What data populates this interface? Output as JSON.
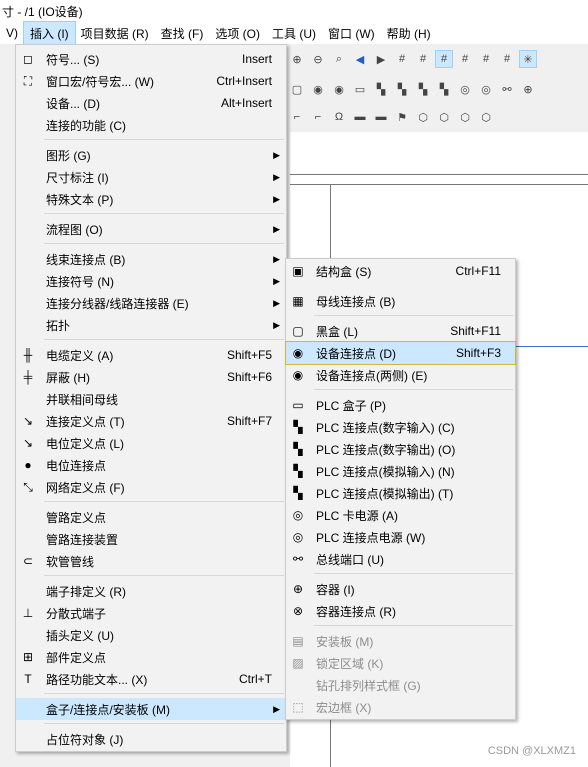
{
  "window": {
    "title": "寸 - /1 (IO设备)"
  },
  "menubar": [
    "V)",
    "插入 (I)",
    "项目数据 (R)",
    "查找 (F)",
    "选项 (O)",
    "工具 (U)",
    "窗口 (W)",
    "帮助 (H)"
  ],
  "insert_menu": [
    {
      "icon": "◻",
      "label": "符号... (S)",
      "shortcut": "Insert"
    },
    {
      "icon": "⛶",
      "label": "窗口宏/符号宏... (W)",
      "shortcut": "Ctrl+Insert"
    },
    {
      "icon": "",
      "label": "设备... (D)",
      "shortcut": "Alt+Insert"
    },
    {
      "icon": "",
      "label": "连接的功能 (C)",
      "shortcut": ""
    },
    {
      "icon": "",
      "label": "图形 (G)",
      "shortcut": "",
      "arrow": true
    },
    {
      "icon": "",
      "label": "尺寸标注 (I)",
      "shortcut": "",
      "arrow": true
    },
    {
      "icon": "",
      "label": "特殊文本 (P)",
      "shortcut": "",
      "arrow": true
    },
    {
      "icon": "",
      "label": "流程图 (O)",
      "shortcut": "",
      "arrow": true
    },
    {
      "icon": "",
      "label": "线束连接点 (B)",
      "shortcut": "",
      "arrow": true
    },
    {
      "icon": "",
      "label": "连接符号 (N)",
      "shortcut": "",
      "arrow": true
    },
    {
      "icon": "",
      "label": "连接分线器/线路连接器 (E)",
      "shortcut": "",
      "arrow": true
    },
    {
      "icon": "",
      "label": "拓扑",
      "shortcut": "",
      "arrow": true
    },
    {
      "icon": "╫",
      "label": "电缆定义 (A)",
      "shortcut": "Shift+F5"
    },
    {
      "icon": "╪",
      "label": "屏蔽 (H)",
      "shortcut": "Shift+F6"
    },
    {
      "icon": "",
      "label": "并联相间母线",
      "shortcut": ""
    },
    {
      "icon": "↘",
      "label": "连接定义点 (T)",
      "shortcut": "Shift+F7"
    },
    {
      "icon": "↘",
      "label": "电位定义点 (L)",
      "shortcut": ""
    },
    {
      "icon": "●",
      "label": "电位连接点",
      "shortcut": ""
    },
    {
      "icon": "⤡",
      "label": "网络定义点 (F)",
      "shortcut": ""
    },
    {
      "icon": "",
      "label": "管路定义点",
      "shortcut": ""
    },
    {
      "icon": "",
      "label": "管路连接装置",
      "shortcut": ""
    },
    {
      "icon": "⊂",
      "label": "软管管线",
      "shortcut": ""
    },
    {
      "icon": "",
      "label": "端子排定义 (R)",
      "shortcut": ""
    },
    {
      "icon": "⊥",
      "label": "分散式端子",
      "shortcut": ""
    },
    {
      "icon": "",
      "label": "插头定义 (U)",
      "shortcut": ""
    },
    {
      "icon": "⊞",
      "label": "部件定义点",
      "shortcut": ""
    },
    {
      "icon": "T",
      "label": "路径功能文本... (X)",
      "shortcut": "Ctrl+T"
    },
    {
      "icon": "",
      "label": "盒子/连接点/安装板 (M)",
      "shortcut": "",
      "arrow": true
    },
    {
      "icon": "",
      "label": "占位符对象 (J)",
      "shortcut": ""
    }
  ],
  "sub_menu": [
    {
      "icon": "▣",
      "label": "结构盒 (S)",
      "shortcut": "Ctrl+F11"
    },
    {
      "icon": "▦",
      "label": "母线连接点 (B)",
      "shortcut": ""
    },
    {
      "icon": "▢",
      "label": "黑盒 (L)",
      "shortcut": "Shift+F11"
    },
    {
      "icon": "◉",
      "label": "设备连接点 (D)",
      "shortcut": "Shift+F3"
    },
    {
      "icon": "◉",
      "label": "设备连接点(两侧) (E)",
      "shortcut": ""
    },
    {
      "icon": "▭",
      "label": "PLC 盒子 (P)",
      "shortcut": ""
    },
    {
      "icon": "▚",
      "label": "PLC 连接点(数字输入) (C)",
      "shortcut": ""
    },
    {
      "icon": "▚",
      "label": "PLC 连接点(数字输出) (O)",
      "shortcut": ""
    },
    {
      "icon": "▚",
      "label": "PLC 连接点(模拟输入) (N)",
      "shortcut": ""
    },
    {
      "icon": "▚",
      "label": "PLC 连接点(模拟输出) (T)",
      "shortcut": ""
    },
    {
      "icon": "◎",
      "label": "PLC 卡电源 (A)",
      "shortcut": ""
    },
    {
      "icon": "◎",
      "label": "PLC 连接点电源 (W)",
      "shortcut": ""
    },
    {
      "icon": "⚯",
      "label": "总线端口 (U)",
      "shortcut": ""
    },
    {
      "icon": "⊕",
      "label": "容器 (I)",
      "shortcut": ""
    },
    {
      "icon": "⊗",
      "label": "容器连接点 (R)",
      "shortcut": ""
    },
    {
      "icon": "▤",
      "label": "安装板 (M)",
      "shortcut": ""
    },
    {
      "icon": "▨",
      "label": "锁定区域 (K)",
      "shortcut": ""
    },
    {
      "icon": "",
      "label": "钻孔排列样式框 (G)",
      "shortcut": ""
    },
    {
      "icon": "⬚",
      "label": "宏边框 (X)",
      "shortcut": ""
    }
  ],
  "watermark": "CSDN @XLXMZ1"
}
